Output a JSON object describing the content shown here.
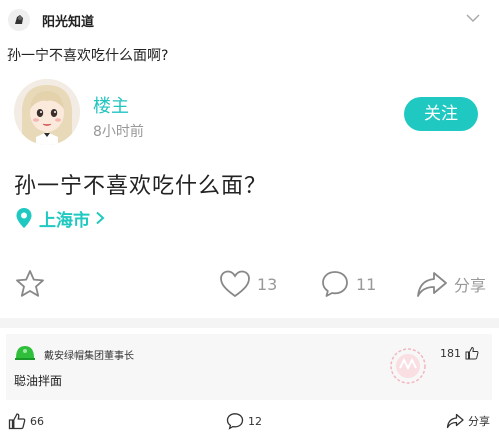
{
  "header": {
    "site_name": "阳光知道"
  },
  "question": {
    "title": "孙一宁不喜欢吃什么面啊?"
  },
  "post": {
    "author": "楼主",
    "time": "8小时前",
    "follow_label": "关注",
    "body": "孙一宁不喜欢吃什么面？",
    "location": "上海市"
  },
  "actions": {
    "like_count": "13",
    "comment_count": "11",
    "share_label": "分享"
  },
  "comment": {
    "author": "戴安绿帽集团董事长",
    "likes": "181",
    "text": "聪油拌面"
  },
  "footer": {
    "like_count": "66",
    "comment_count": "12",
    "share_label": "分享"
  },
  "colors": {
    "accent": "#1fc9c1",
    "muted": "#999999"
  }
}
